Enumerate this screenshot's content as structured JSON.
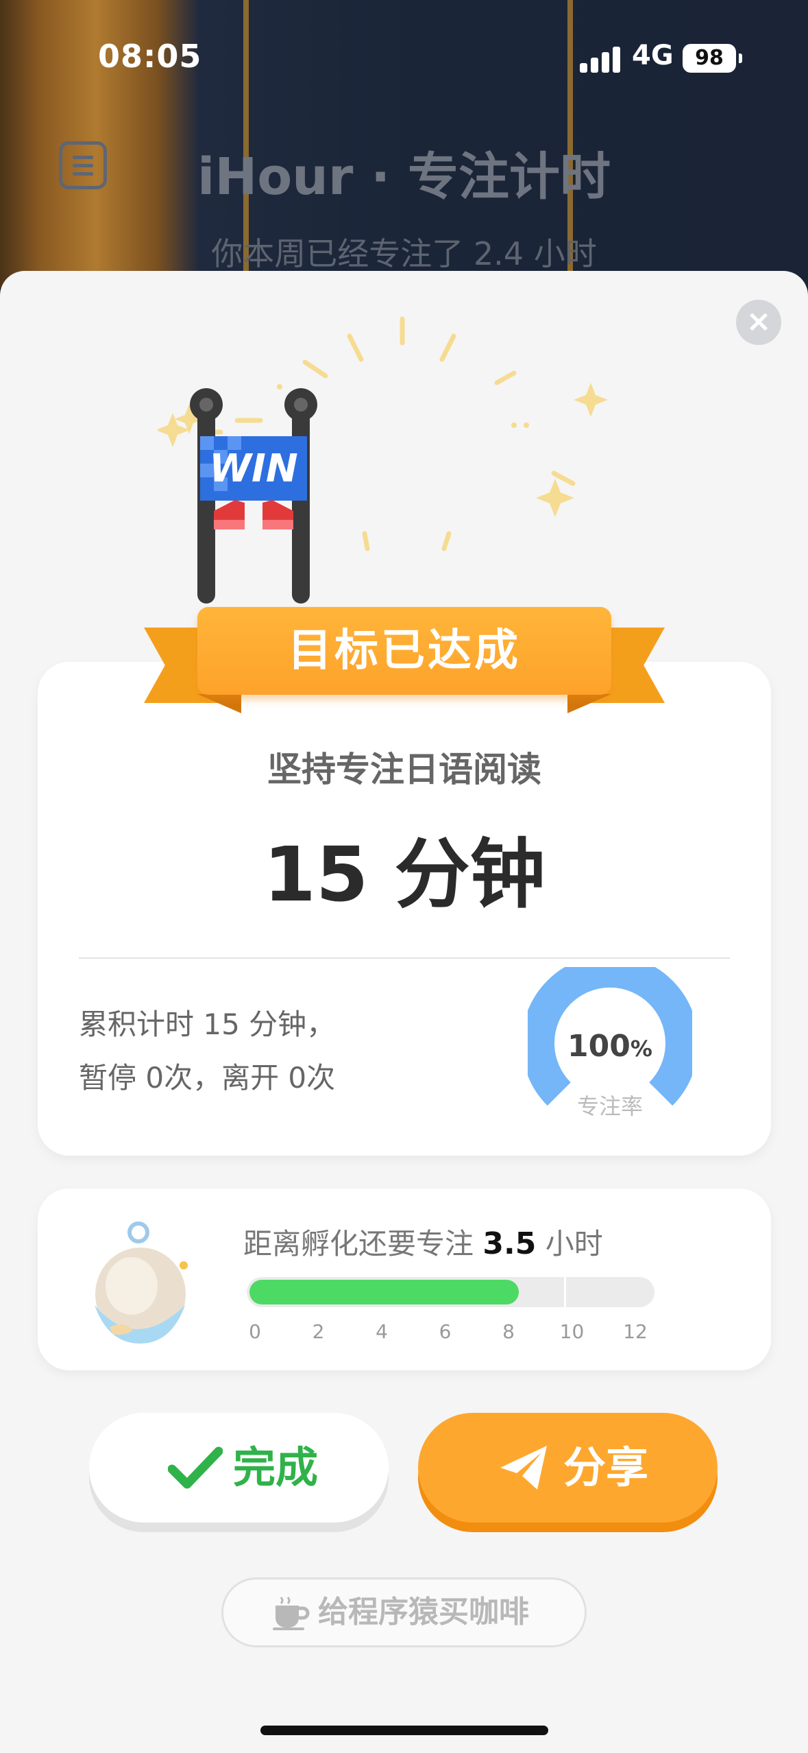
{
  "status_bar": {
    "time": "08:05",
    "network": "4G",
    "battery": "98"
  },
  "header": {
    "title": "iHour · 专注计时",
    "subtitle": "你本周已经专注了 2.4 小时"
  },
  "result": {
    "banner_text": "WIN",
    "ribbon_label": "目标已达成",
    "task_name": "坚持专注日语阅读",
    "duration": "15 分钟",
    "stats_line1": "累积计时 15 分钟，",
    "stats_line2": "暂停 0次，离开 0次",
    "focus_rate_value": "100",
    "focus_rate_unit": "%",
    "focus_rate_label": "专注率",
    "focus_rate_fraction": 1.0
  },
  "hatch": {
    "prefix": "距离孵化还要专注",
    "remaining": "3.5",
    "unit": "小时",
    "progress_hours": 8.5,
    "goal_hours": 10,
    "axis_max": 12,
    "ticks": [
      "0",
      "2",
      "4",
      "6",
      "8",
      "10",
      "12"
    ]
  },
  "actions": {
    "done_label": "完成",
    "share_label": "分享",
    "coffee_label": "给程序猿买咖啡"
  },
  "colors": {
    "accent_orange": "#FEA72E",
    "success_green": "#4CD964",
    "gauge_blue": "#74B6F8"
  },
  "icons": [
    "menu-icon",
    "close-icon",
    "win-trophy-icon",
    "egg-pet-icon",
    "checkmark-icon",
    "paper-plane-icon",
    "coffee-cup-icon"
  ]
}
